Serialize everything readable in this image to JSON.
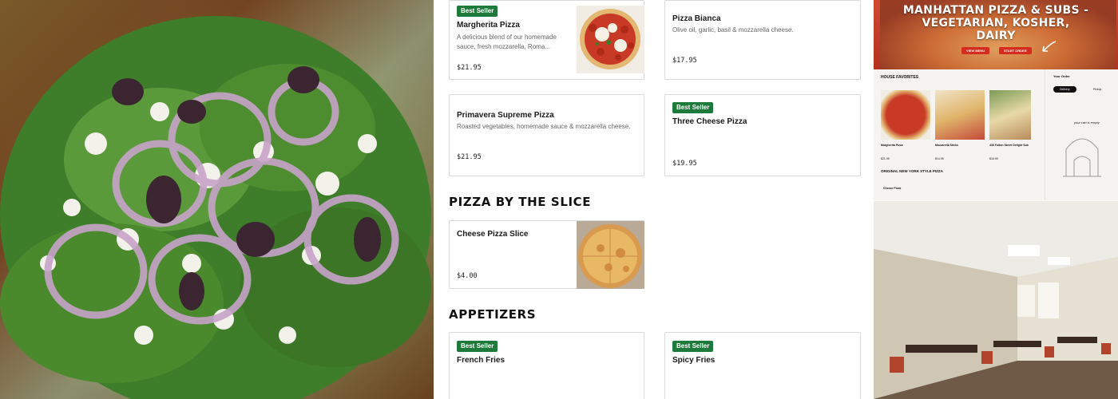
{
  "menu": {
    "badge_label": "Best Seller",
    "items": [
      {
        "name": "Margherita Pizza",
        "desc": "A delicious blend of our homemade sauce, fresh mozzarella, Roma...",
        "price": "$21.95",
        "best_seller": true
      },
      {
        "name": "Pizza Bianca",
        "desc": "Olive oil, garlic, basil & mozzarella cheese.",
        "price": "$17.95",
        "best_seller": false
      },
      {
        "name": "Primavera Supreme Pizza",
        "desc": "Roasted vegetables, homemade sauce & mozzarella cheese.",
        "price": "$21.95",
        "best_seller": false
      },
      {
        "name": "Three Cheese Pizza",
        "desc": "",
        "price": "$19.95",
        "best_seller": true
      }
    ],
    "sections": [
      {
        "title": "PIZZA BY THE SLICE",
        "items": [
          {
            "name": "Cheese Pizza Slice",
            "price": "$4.00"
          }
        ]
      },
      {
        "title": "APPETIZERS",
        "items": [
          {
            "name": "French Fries"
          },
          {
            "name": "Spicy Fries"
          }
        ]
      }
    ]
  },
  "hero": {
    "line1": "MANHATTAN PIZZA & SUBS -",
    "line2": "VEGETARIAN, KOSHER,",
    "line3": "DAIRY",
    "btn_view_menu": "VIEW MENU",
    "btn_start_order": "START ORDER"
  },
  "mini_site": {
    "house_favorites": "HOUSE FAVORITES",
    "original_style": "ORIGINAL NEW YORK STYLE PIZZA",
    "your_order": "Your Order",
    "delivery": "Delivery",
    "pickup": "Pickup",
    "cart_empty": "your cart is empty",
    "items": [
      "Margherita Pizza",
      "Mozzarella Sticks",
      "435 Fulton Street Delight Sub"
    ],
    "prices": [
      "$21.95",
      "$14.95",
      "$16.95"
    ],
    "cheese_pizza": "Cheese Pizza"
  },
  "colors": {
    "badge_green": "#1d7a3a",
    "accent_red": "#d62b1f"
  }
}
